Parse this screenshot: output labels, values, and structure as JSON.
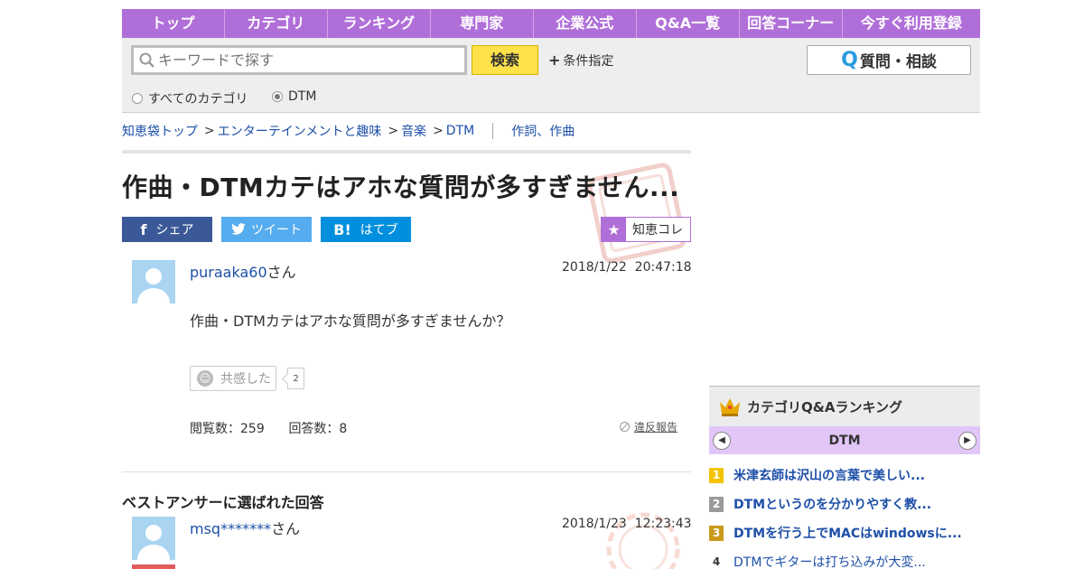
{
  "nav": [
    "トップ",
    "カテゴリ",
    "ランキング",
    "専門家",
    "企業公式",
    "Q&A一覧",
    "回答コーナー",
    "今すぐ利用登録"
  ],
  "search": {
    "placeholder": "キーワードで探す",
    "button": "検索",
    "conditions": "条件指定",
    "ask_button": "質問・相談",
    "scope_all": "すべてのカテゴリ",
    "scope_current": "DTM"
  },
  "breadcrumb": {
    "items": [
      "知恵袋トップ",
      "エンターテインメントと趣味",
      "音楽",
      "DTM"
    ],
    "separator": ">",
    "related": "作詞、作曲"
  },
  "question": {
    "title": "作曲・DTMカテはアホな質問が多すぎません...",
    "username": "puraaka60",
    "honorific": "さん",
    "date": "2018/1/22  20:47:18",
    "body": "作曲・DTMカテはアホな質問が多すぎませんか？",
    "empathy_label": "共感した",
    "empathy_count": "2",
    "views": "閲覧数：259",
    "answers": "回答数：8",
    "report": "違反報告"
  },
  "share": {
    "facebook": "シェア",
    "twitter": "ツイート",
    "hatena": "はてブ",
    "chiecolle": "知恵コレ"
  },
  "best_answer": {
    "heading": "ベストアンサーに選ばれた回答",
    "username": "msq*******",
    "honorific": "さん",
    "date": "2018/1/23  12:23:43"
  },
  "ranking": {
    "title": "カテゴリQ&Aランキング",
    "category": "DTM",
    "items": [
      {
        "rank": "1",
        "text": "米津玄師は沢山の言葉で美しい..."
      },
      {
        "rank": "2",
        "text": "DTMというのを分かりやすく教..."
      },
      {
        "rank": "3",
        "text": "DTMを行う上でMACはwindowsに..."
      },
      {
        "rank": "4",
        "text": "DTMでギターは打ち込みが大変..."
      }
    ]
  },
  "colors": {
    "brand_purple": "#b06fd8",
    "search_yellow": "#ffe14a",
    "facebook": "#3b5998",
    "twitter": "#55acee",
    "hatena": "#008fde",
    "link_blue": "#1d4fa8",
    "rank_gold": "#f5c400",
    "rank_silver": "#9a9a9a",
    "rank_bronze": "#c99a1b"
  }
}
